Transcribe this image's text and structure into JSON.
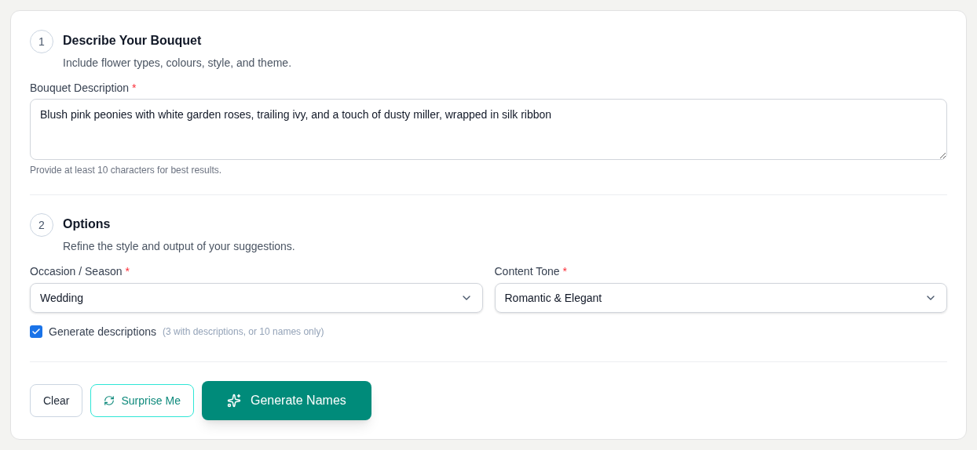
{
  "sections": [
    {
      "number": "1",
      "title": "Describe Your Bouquet",
      "subtitle": "Include flower types, colours, style, and theme.",
      "kind": "description",
      "field": {
        "label": "Bouquet Description",
        "required_mark": "*",
        "value": "Blush pink peonies with white garden roses, trailing ivy, and a touch of dusty miller, wrapped in silk ribbon",
        "help": "Provide at least 10 characters for best results."
      }
    },
    {
      "number": "2",
      "title": "Options",
      "subtitle": "Refine the style and output of your suggestions.",
      "kind": "options",
      "selects": [
        {
          "label": "Occasion / Season",
          "required_mark": "*",
          "value": "Wedding"
        },
        {
          "label": "Content Tone",
          "required_mark": "*",
          "value": "Romantic & Elegant"
        }
      ],
      "checkbox": {
        "label": "Generate descriptions",
        "hint": "(3 with descriptions, or 10 names only)",
        "checked": true
      }
    }
  ],
  "buttons": [
    {
      "label": "Clear",
      "kind": "plain"
    },
    {
      "label": "Surprise Me",
      "kind": "accent-outline"
    },
    {
      "label": "Generate Names",
      "kind": "primary"
    }
  ]
}
